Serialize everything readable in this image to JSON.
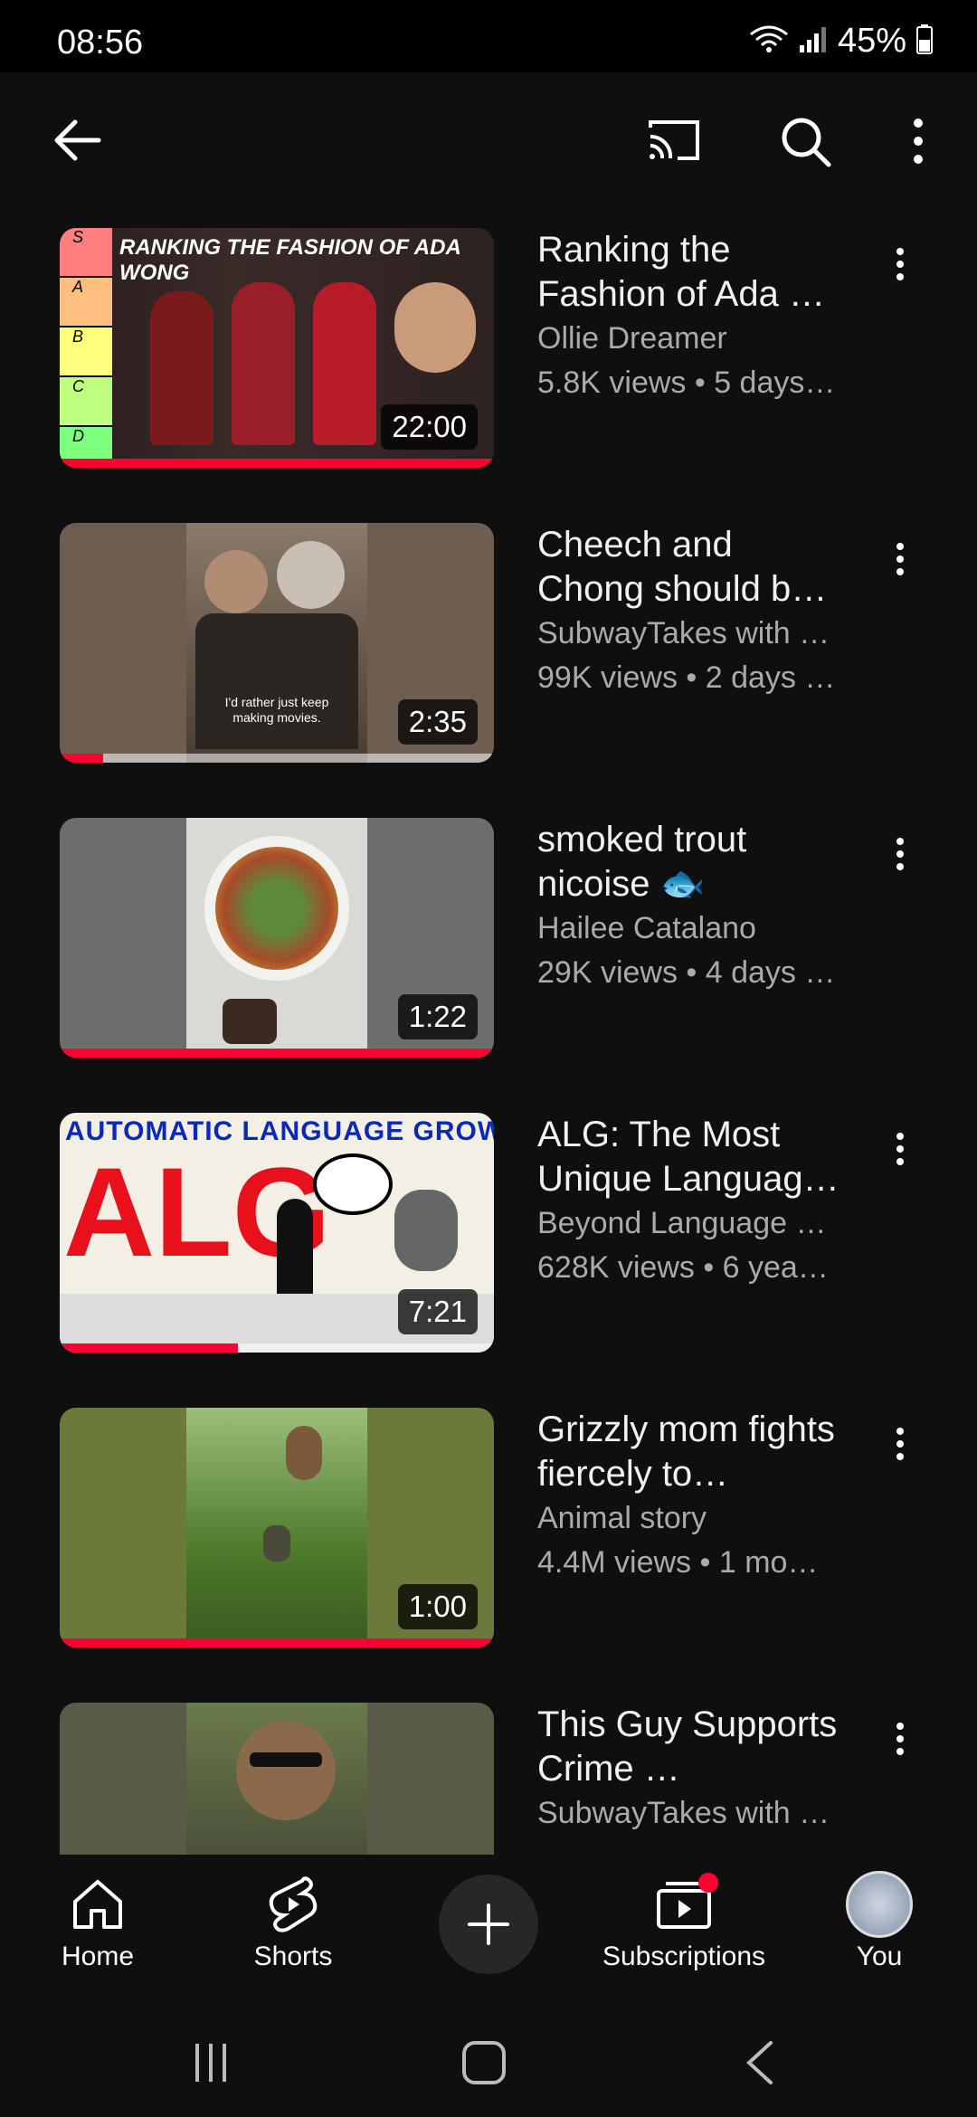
{
  "status": {
    "time": "08:56",
    "battery": "45%"
  },
  "app_bar": {
    "back_icon": "arrow-left-icon",
    "cast_icon": "cast-icon",
    "search_icon": "search-icon",
    "more_icon": "more-vert-icon"
  },
  "videos": [
    {
      "title": "Ranking the Fashion of Ada …",
      "channel": "Ollie Dreamer",
      "stats": "5.8K views • 5 days…",
      "duration": "22:00",
      "progress": 1.0,
      "thumb_text": [
        "S",
        "A",
        "B",
        "C",
        "D",
        "RANKING THE FASHION OF ADA WONG"
      ]
    },
    {
      "title": "Cheech and Chong should b…",
      "channel": "SubwayTakes with …",
      "stats": "99K views • 2 days …",
      "duration": "2:35",
      "progress": 0.1,
      "thumb_text": [
        "I'd rather just keep making movies."
      ]
    },
    {
      "title": "smoked trout nicoise 🐟",
      "channel": "Hailee Catalano",
      "stats": "29K views • 4 days …",
      "duration": "1:22",
      "progress": 1.0,
      "thumb_text": []
    },
    {
      "title": "ALG: The Most Unique Languag…",
      "channel": "Beyond Language …",
      "stats": "628K views • 6 yea…",
      "duration": "7:21",
      "progress": 0.41,
      "thumb_text": [
        "AUTOMATIC LANGUAGE GROWTH",
        "ALG"
      ]
    },
    {
      "title": "Grizzly mom fights fiercely to…",
      "channel": "Animal story",
      "stats": "4.4M views • 1 mo…",
      "duration": "1:00",
      "progress": 1.0,
      "thumb_text": []
    },
    {
      "title": "This Guy Supports Crime …",
      "channel": "SubwayTakes with …",
      "stats": "",
      "duration": "",
      "progress": 0,
      "thumb_text": []
    }
  ],
  "bottom_nav": {
    "home": "Home",
    "shorts": "Shorts",
    "subscriptions": "Subscriptions",
    "you": "You"
  },
  "colors": {
    "accent": "#ff0033",
    "background": "#0f0f0f",
    "secondary_text": "#aaaaaa"
  }
}
